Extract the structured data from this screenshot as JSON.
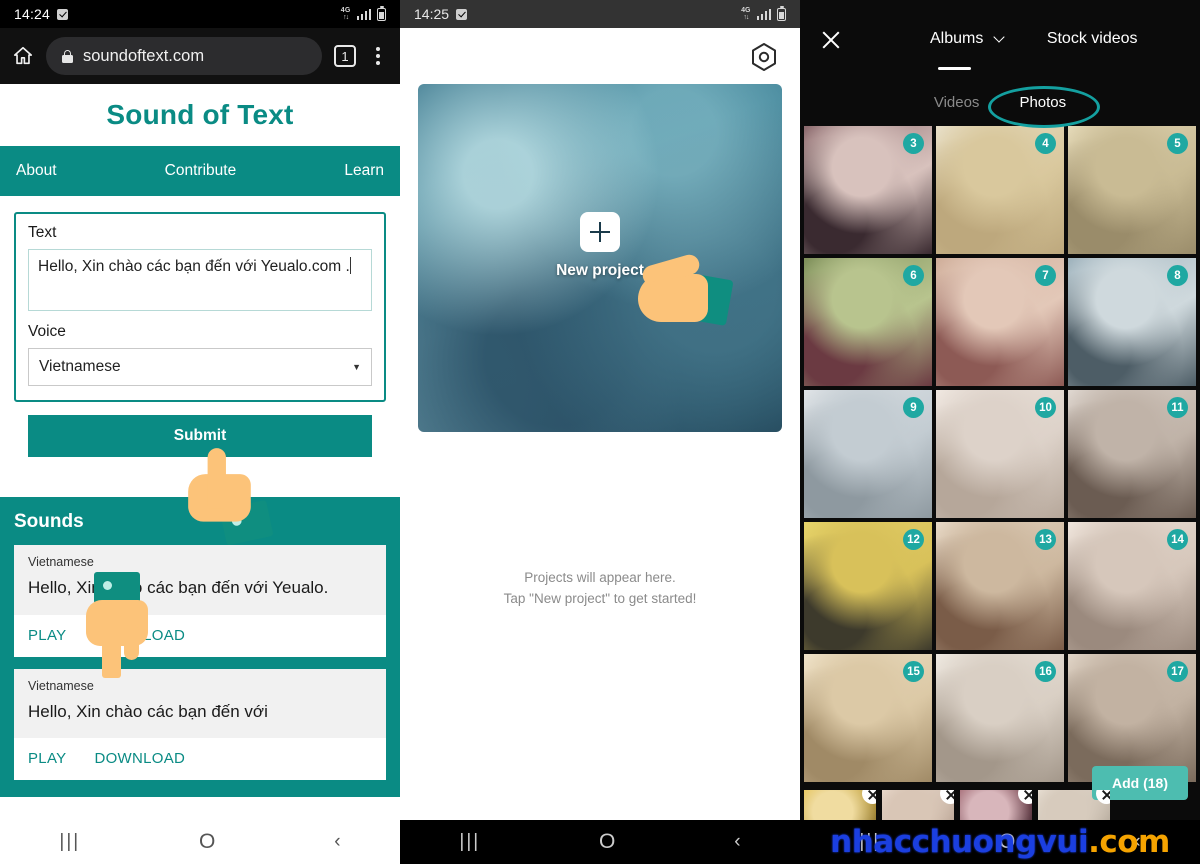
{
  "panel1": {
    "status": {
      "time": "14:24",
      "network": "4G",
      "battery_icon": "battery-icon"
    },
    "browser": {
      "url": "soundoftext.com",
      "tab_count": "1",
      "home_icon": "home-icon",
      "lock_icon": "lock-icon",
      "menu_icon": "kebab-menu-icon"
    },
    "brand_title": "Sound of Text",
    "nav": [
      "About",
      "Contribute",
      "Learn"
    ],
    "form": {
      "text_label": "Text",
      "text_value": "Hello, Xin chào các bạn đến với Yeualo.com .",
      "voice_label": "Voice",
      "voice_value": "Vietnamese",
      "submit_label": "Submit"
    },
    "sounds": {
      "heading": "Sounds",
      "items": [
        {
          "lang": "Vietnamese",
          "text": "Hello, Xin chào các bạn đến với Yeualo.",
          "play_label": "PLAY",
          "download_label": "DOWNLOAD"
        },
        {
          "lang": "Vietnamese",
          "text": "Hello, Xin chào các bạn đến với",
          "play_label": "PLAY",
          "download_label": "DOWNLOAD"
        }
      ]
    },
    "navbar": {
      "recent": "|||",
      "home": "O",
      "back": "‹"
    }
  },
  "panel2": {
    "status": {
      "time": "14:25",
      "network": "4G"
    },
    "settings_icon": "hex-settings-icon",
    "new_project_label": "New project",
    "plus_icon": "plus-icon",
    "empty_line1": "Projects will appear here.",
    "empty_line2": "Tap \"New project\" to get started!",
    "navbar": {
      "recent": "|||",
      "home": "O",
      "back": "‹"
    }
  },
  "panel3": {
    "close_icon": "close-icon",
    "tabs": {
      "albums": "Albums",
      "albums_chevron": "chevron-down-icon",
      "stock": "Stock videos"
    },
    "subtabs": [
      {
        "label": "Videos",
        "active": false
      },
      {
        "label": "Photos",
        "active": true
      }
    ],
    "grid_badges": [
      "3",
      "4",
      "5",
      "6",
      "7",
      "8",
      "9",
      "10",
      "11",
      "12",
      "13",
      "14",
      "15",
      "16",
      "17"
    ],
    "selected_thumbs": 4,
    "strip_arrow": "›",
    "add_label": "Add (18)",
    "navbar": {
      "recent": "|||",
      "home": "O",
      "back": "‹"
    }
  },
  "watermark": {
    "name": "nhacchuongvui",
    "tld": ".com"
  },
  "colors": {
    "teal": "#0a8b84",
    "teal_light": "#4dbdb0",
    "badge_teal": "#1fa8a2",
    "ring_teal": "#14a0a0",
    "watermark_blue": "#1b3fe0",
    "watermark_orange": "#f5a300"
  }
}
